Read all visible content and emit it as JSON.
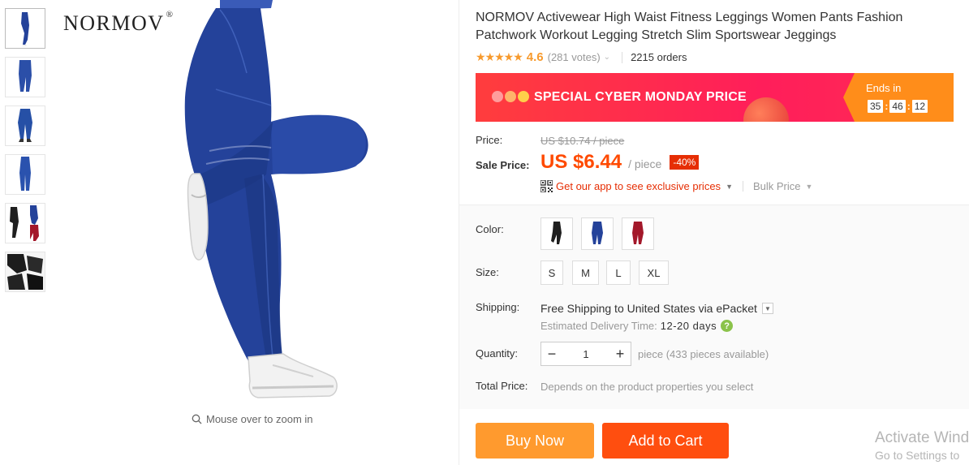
{
  "thumbnails": [
    {
      "name": "thumb-front-blue"
    },
    {
      "name": "thumb-side-blue"
    },
    {
      "name": "thumb-back-blue"
    },
    {
      "name": "thumb-full-blue"
    },
    {
      "name": "thumb-colors"
    },
    {
      "name": "thumb-detail-black"
    }
  ],
  "gallery": {
    "brand": "NORMOV",
    "brand_mark": "®",
    "zoom_hint": "Mouse over to zoom in"
  },
  "product": {
    "title": "NORMOV Activewear High Waist Fitness Leggings Women Pants Fashion Patchwork Workout Legging Stretch Slim Sportswear Jeggings",
    "stars": "★★★★★",
    "rating": "4.6",
    "votes": "(281 votes)",
    "orders": "2215 orders"
  },
  "promo": {
    "label": "SPECIAL CYBER MONDAY PRICE",
    "ends_in": "Ends in",
    "hours": "35",
    "minutes": "46",
    "seconds": "12"
  },
  "price": {
    "price_label": "Price:",
    "original": "US $10.74 / piece",
    "sale_label": "Sale Price:",
    "sale": "US $6.44",
    "per": "/ piece",
    "discount": "-40%",
    "app_text": "Get our app to see exclusive prices",
    "bulk": "Bulk Price"
  },
  "options": {
    "color_label": "Color:",
    "colors": [
      {
        "name": "black",
        "hex": "#1f1f1f"
      },
      {
        "name": "blue",
        "hex": "#24429a"
      },
      {
        "name": "red",
        "hex": "#a3182a"
      }
    ],
    "size_label": "Size:",
    "sizes": [
      "S",
      "M",
      "L",
      "XL"
    ],
    "shipping_label": "Shipping:",
    "shipping_free": "Free Shipping to",
    "shipping_dest": "United States via ePacket",
    "est_label": "Estimated Delivery Time:",
    "est_days": "12-20 days",
    "quantity_label": "Quantity:",
    "quantity": "1",
    "available": "piece (433 pieces available)",
    "total_label": "Total Price:",
    "total_text": "Depends on the product properties you select"
  },
  "actions": {
    "buy_now": "Buy Now",
    "add_to_cart": "Add to Cart"
  },
  "watermark": {
    "line1": "Activate Wind",
    "line2": "Go to Settings to"
  },
  "colors": {
    "orange": "#ff9a2e",
    "red_orange": "#ff4e0f",
    "price": "#ff4a00",
    "promo_pink": "#ff1e5a",
    "legging_blue": "#24429a"
  }
}
